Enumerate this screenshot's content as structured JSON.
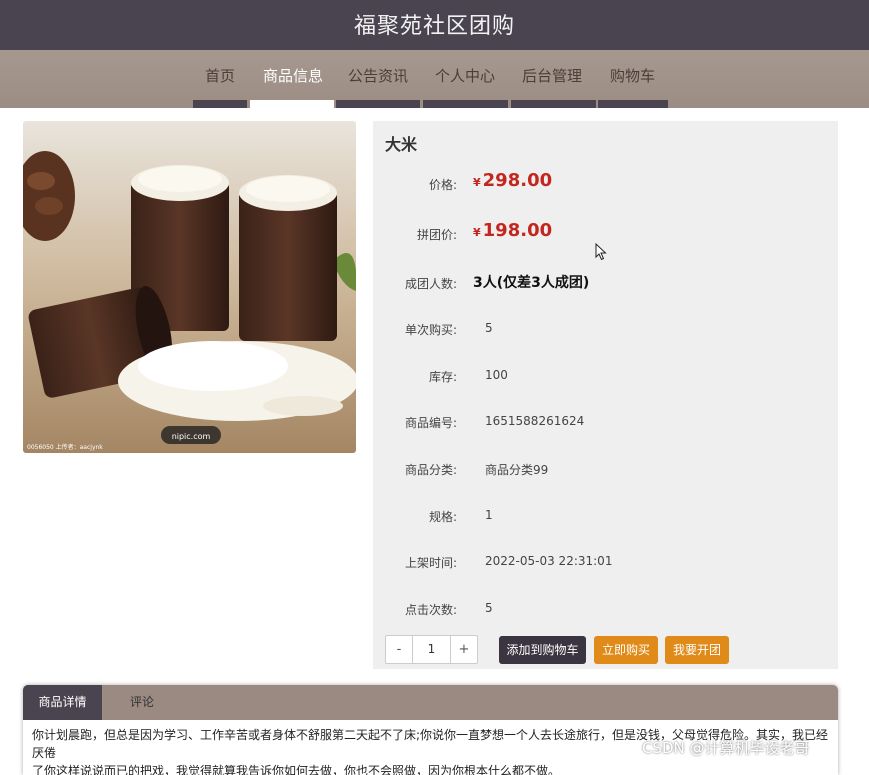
{
  "site": {
    "title": "福聚苑社区团购"
  },
  "nav": {
    "items": [
      {
        "label": "首页"
      },
      {
        "label": "商品信息"
      },
      {
        "label": "公告资讯"
      },
      {
        "label": "个人中心"
      },
      {
        "label": "后台管理"
      },
      {
        "label": "购物车"
      }
    ]
  },
  "product": {
    "name": "大米",
    "currency_symbol": "¥",
    "price_label": "价格:",
    "price": "298.00",
    "group_price_label": "拼团价:",
    "group_price": "198.00",
    "group_size_label": "成团人数:",
    "group_size": "3人(仅差3人成团)",
    "per_order_label": "单次购买:",
    "per_order": "5",
    "stock_label": "库存:",
    "stock": "100",
    "code_label": "商品编号:",
    "code": "1651588261624",
    "category_label": "商品分类:",
    "category": "商品分类99",
    "spec_label": "规格:",
    "spec": "1",
    "listed_label": "上架时间:",
    "listed": "2022-05-03 22:31:01",
    "clicks_label": "点击次数:",
    "clicks": "5",
    "image_watermark": "nipic.com",
    "image_caption": "0056050 上传者：aacjynk"
  },
  "quantity": {
    "minus": "-",
    "value": "1",
    "plus": "+"
  },
  "actions": {
    "add_to_cart": "添加到购物车",
    "buy_now": "立即购买",
    "start_group": "我要开团"
  },
  "detail": {
    "tabs": [
      {
        "label": "商品详情"
      },
      {
        "label": "评论"
      }
    ],
    "text_line1": "你计划晨跑，但总是因为学习、工作辛苦或者身体不舒服第二天起不了床;你说你一直梦想一个人去长途旅行，但是没钱，父母觉得危险。其实，我已经厌倦",
    "text_line2": "了你这样说说而已的把戏，我觉得就算我告诉你如何去做，你也不会照做，因为你根本什么都不做。"
  },
  "watermark": "CSDN @计算机毕设老哥",
  "colors": {
    "header_bg": "#4a4350",
    "nav_bg": "#a7988f",
    "price_red": "#c3261e",
    "accent_orange": "#e08a1a",
    "panel_bg": "#efefef"
  }
}
